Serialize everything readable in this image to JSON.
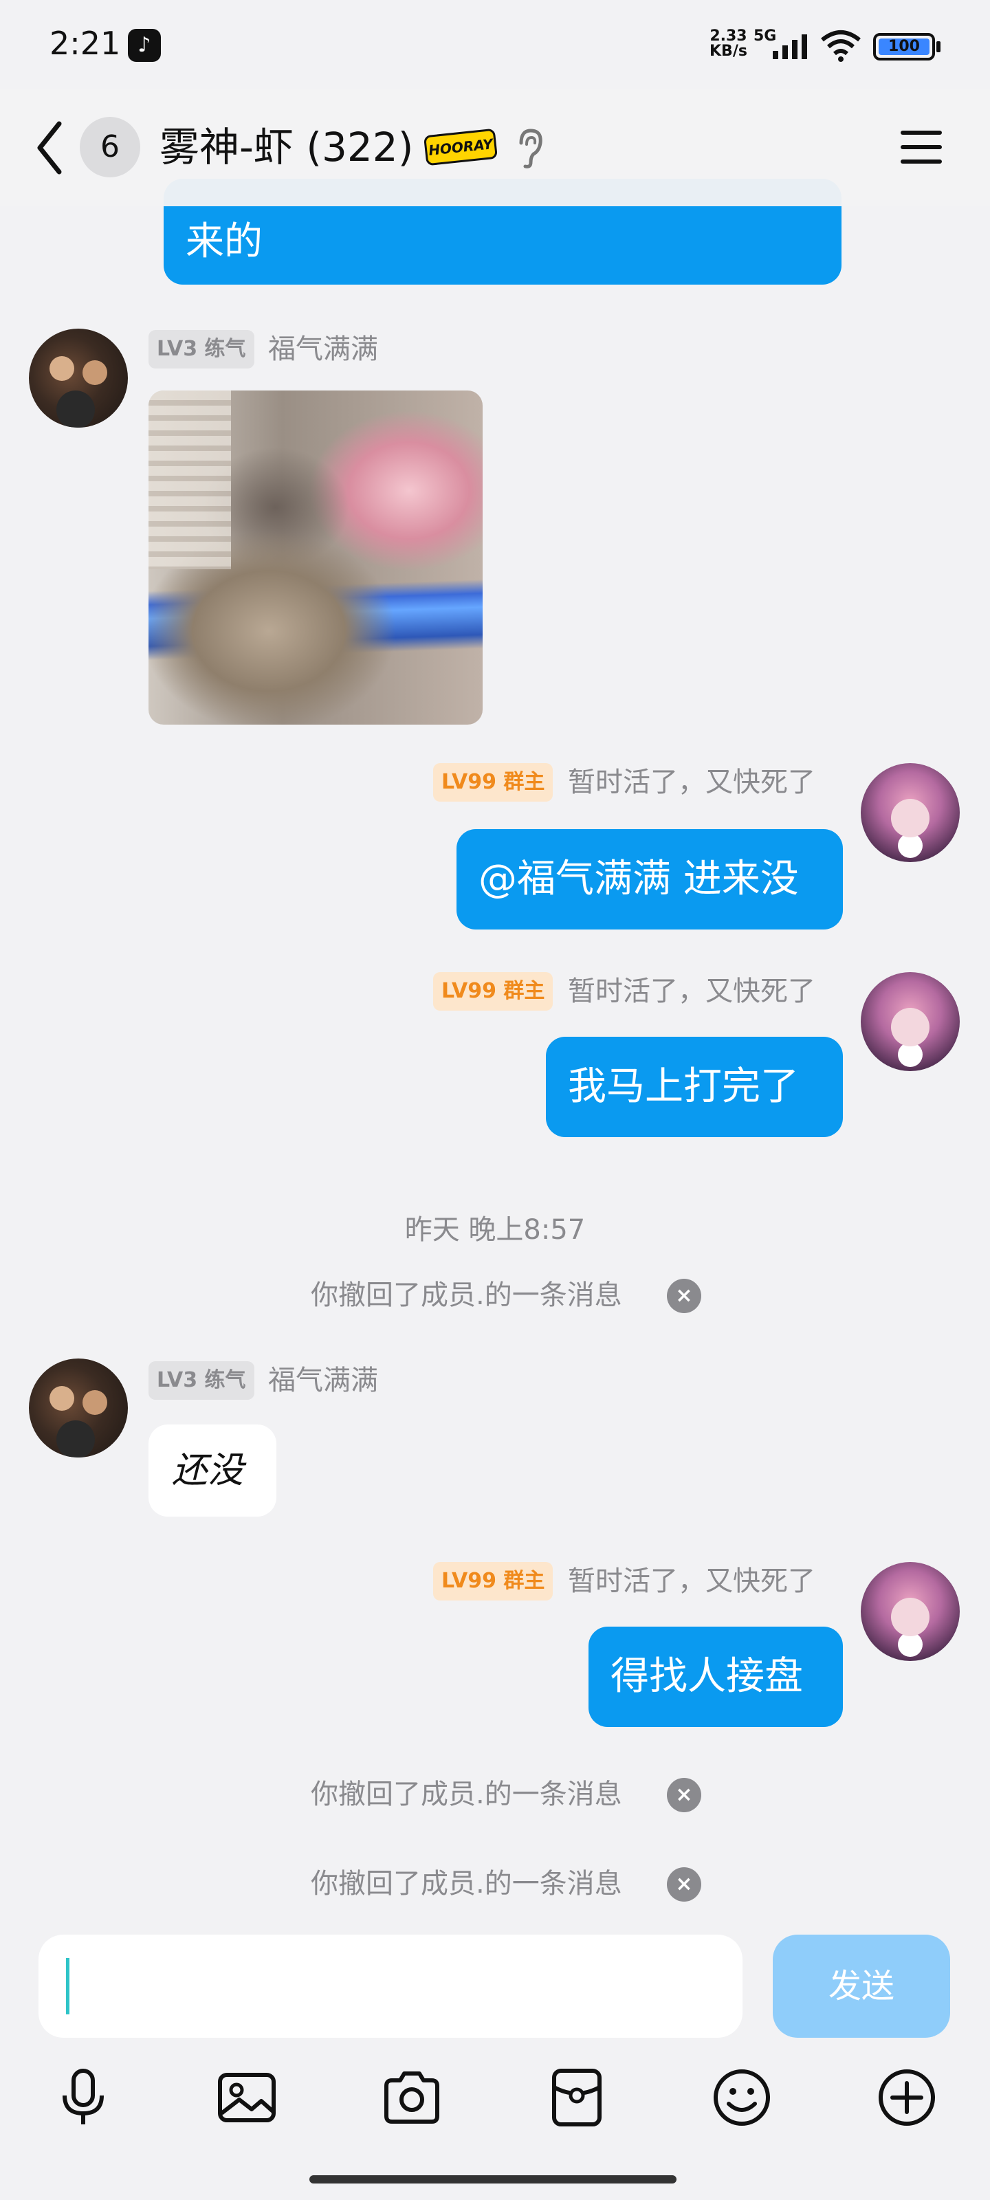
{
  "status_bar": {
    "time": "2:21",
    "net_speed_value": "2.33",
    "net_speed_unit": "KB/s",
    "network_type": "5G",
    "battery": "100",
    "icons": [
      "tiktok-icon",
      "signal-icon",
      "wifi-icon",
      "battery-icon"
    ]
  },
  "header": {
    "unread_count": "6",
    "title": "雾神-虾 (322)",
    "badge_text": "HOORAY",
    "icons": [
      "back-icon",
      "ear-icon",
      "menu-icon"
    ]
  },
  "messages": {
    "m0": {
      "text": "来的"
    },
    "m1": {
      "level": "LV3 练气",
      "sender": "福气满满",
      "content": "image"
    },
    "m2": {
      "level": "LV99 群主",
      "sender": "暂时活了，又快死了",
      "text": "@福气满满 进来没"
    },
    "m3": {
      "level": "LV99 群主",
      "sender": "暂时活了，又快死了",
      "text": "我马上打完了"
    },
    "timestamp": "昨天 晚上8:57",
    "recall1": "你撤回了成员.的一条消息",
    "m4": {
      "level": "LV3 练气",
      "sender": "福气满满",
      "text": "还没"
    },
    "m5": {
      "level": "LV99 群主",
      "sender": "暂时活了，又快死了",
      "text": "得找人接盘"
    },
    "recall2": "你撤回了成员.的一条消息",
    "recall3": "你撤回了成员.的一条消息"
  },
  "input": {
    "value": "",
    "send_label": "发送"
  },
  "toolbar": {
    "icons": [
      "microphone-icon",
      "image-icon",
      "camera-icon",
      "red-packet-icon",
      "emoji-icon",
      "plus-icon"
    ]
  },
  "colors": {
    "bubble_blue": "#0a9af0",
    "send_disabled": "#8fcdfa",
    "background": "#f2f2f4"
  }
}
